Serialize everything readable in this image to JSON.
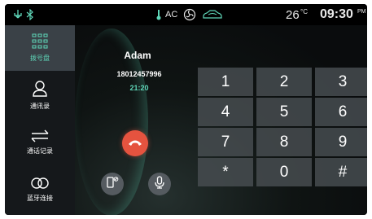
{
  "status_bar": {
    "usb_icon": "usb-icon",
    "bluetooth_icon": "bluetooth-icon",
    "thermo_icon": "thermometer-icon",
    "ac_label": "AC",
    "fan_icon": "fan-icon",
    "car_icon": "car-recirculation-icon",
    "temperature": "26",
    "temp_unit": "°C",
    "time": "09:30",
    "ampm": "PM"
  },
  "sidebar": {
    "items": [
      {
        "label": "拨号盘",
        "icon": "dialpad-icon",
        "active": true
      },
      {
        "label": "通讯录",
        "icon": "contacts-icon",
        "active": false
      },
      {
        "label": "通话记录",
        "icon": "call-log-icon",
        "active": false
      },
      {
        "label": "蓝牙连接",
        "icon": "bluetooth-link-icon",
        "active": false
      }
    ]
  },
  "call": {
    "name": "Adam",
    "number": "18012457996",
    "duration": "21:20"
  },
  "keypad": {
    "keys": [
      "1",
      "2",
      "3",
      "4",
      "5",
      "6",
      "7",
      "8",
      "9",
      "*",
      "0",
      "#"
    ]
  },
  "colors": {
    "accent": "#5fd7b9",
    "hangup": "#e5533f",
    "key_bg": "#464c50"
  }
}
